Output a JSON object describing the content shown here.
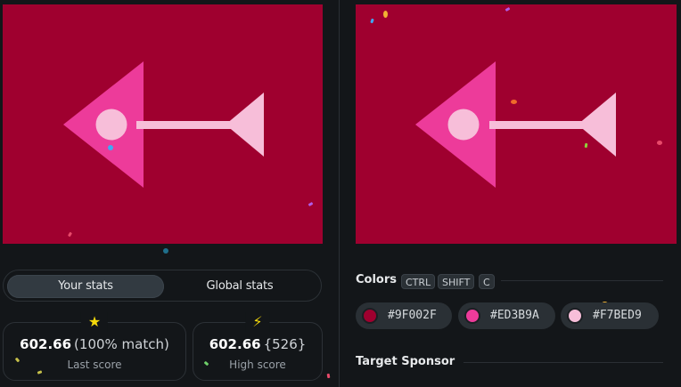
{
  "colors": {
    "primary": "#9F002F",
    "secondary": "#ED3B9A",
    "tertiary": "#F7BED9",
    "background": "#131619"
  },
  "stats_tabs": {
    "your_stats": "Your stats",
    "global_stats": "Global stats",
    "active": "your_stats"
  },
  "last_score": {
    "icon": "star-icon",
    "icon_glyph": "★",
    "value": "602.66",
    "detail": "(100% match)",
    "label": "Last score"
  },
  "high_score": {
    "icon": "lightning-icon",
    "icon_glyph": "⚡",
    "value": "602.66",
    "detail": "{526}",
    "label": "High score"
  },
  "colors_section": {
    "title": "Colors",
    "shortcut_keys": [
      "CTRL",
      "SHIFT",
      "C"
    ],
    "swatches": [
      {
        "hex": "#9F002F",
        "label": "#9F002F"
      },
      {
        "hex": "#ED3B9A",
        "label": "#ED3B9A"
      },
      {
        "hex": "#F7BED9",
        "label": "#F7BED9"
      }
    ]
  },
  "sponsor_section": {
    "title": "Target Sponsor"
  }
}
